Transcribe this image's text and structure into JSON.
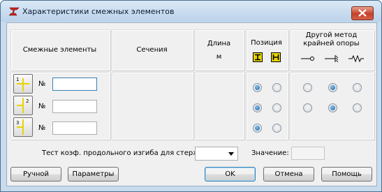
{
  "window": {
    "title": "Характеристики смежных элементов",
    "icon": "beam-app-icon",
    "close_icon": "close-icon"
  },
  "headers": {
    "adjacent": "Смежные элементы",
    "sections": "Сечения",
    "length": "Длина",
    "length_unit": "м",
    "position": "Позиция",
    "other_method_line1": "Другой метод",
    "other_method_line2": "крайней опоры"
  },
  "rows": [
    {
      "number_label": "№",
      "number_value": "",
      "button_icon": "element-1-icon",
      "position_selected": 0,
      "support_selected": 1
    },
    {
      "number_label": "№",
      "number_value": "",
      "button_icon": "element-2-icon",
      "position_selected": 0,
      "support_selected": 1
    },
    {
      "number_label": "№",
      "number_value": "",
      "button_icon": "element-3-icon",
      "position_selected": 0,
      "support_selected": null
    }
  ],
  "bottom": {
    "buckling_label": "Тест коэф. продольного изгиба для стержня:",
    "buckling_value": "",
    "value_label": "Значение:",
    "value": ""
  },
  "buttons": {
    "manual": "Ручной",
    "params": "Параметры",
    "ok": "OK",
    "cancel": "Отмена",
    "help": "Помощь"
  },
  "colors": {
    "accent": "#3c7fb1",
    "icon_yellow": "#e8d400",
    "close_red": "#c5402a"
  }
}
